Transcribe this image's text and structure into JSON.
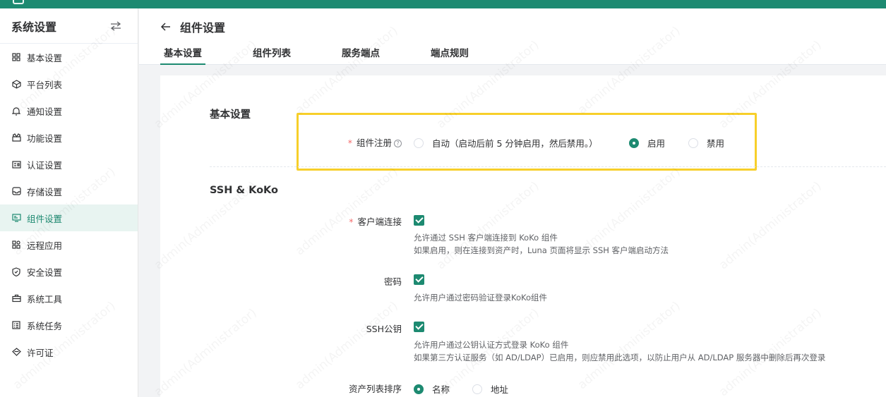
{
  "sidebar": {
    "title": "系统设置",
    "items": [
      {
        "label": "基本设置",
        "icon": "grid-icon"
      },
      {
        "label": "平台列表",
        "icon": "cube-icon"
      },
      {
        "label": "通知设置",
        "icon": "bell-icon"
      },
      {
        "label": "功能设置",
        "icon": "gift-icon"
      },
      {
        "label": "认证设置",
        "icon": "id-card-icon"
      },
      {
        "label": "存储设置",
        "icon": "inbox-icon"
      },
      {
        "label": "组件设置",
        "icon": "monitor-icon",
        "active": true
      },
      {
        "label": "远程应用",
        "icon": "apps-icon"
      },
      {
        "label": "安全设置",
        "icon": "shield-icon"
      },
      {
        "label": "系统工具",
        "icon": "toolbox-icon"
      },
      {
        "label": "系统任务",
        "icon": "task-list-icon"
      },
      {
        "label": "许可证",
        "icon": "license-icon"
      }
    ]
  },
  "header": {
    "title": "组件设置",
    "tabs": [
      {
        "label": "基本设置",
        "active": true
      },
      {
        "label": "组件列表"
      },
      {
        "label": "服务端点"
      },
      {
        "label": "端点规则"
      }
    ]
  },
  "basic": {
    "section_title": "基本设置",
    "registration_label": "组件注册",
    "help_symbol": "?",
    "options": [
      {
        "label": "自动（启动后前 5 分钟启用，然后禁用。）",
        "checked": false
      },
      {
        "label": "启用",
        "checked": true
      },
      {
        "label": "禁用",
        "checked": false
      }
    ]
  },
  "ssh": {
    "section_title": "SSH & KoKo",
    "client_connect_label": "客户端连接",
    "client_connect_help1": "允许通过 SSH 客户端连接到 KoKo 组件",
    "client_connect_help2": "如果启用，则在连接到资产时，Luna 页面将显示 SSH 客户端启动方法",
    "password_label": "密码",
    "password_help": "允许用户通过密码验证登录KoKo组件",
    "pubkey_label": "SSH公钥",
    "pubkey_help1": "允许用户通过公钥认证方式登录 KoKo 组件",
    "pubkey_help2": "如果第三方认证服务（如 AD/LDAP）已启用，则应禁用此选项，以防止用户从 AD/LDAP 服务器中删除后再次登录",
    "asset_sort_label": "资产列表排序",
    "asset_sort_options": [
      {
        "label": "名称",
        "checked": true
      },
      {
        "label": "地址",
        "checked": false
      }
    ]
  },
  "watermark": "admin(Administrator)",
  "colors": {
    "primary": "#1d8a71",
    "highlight": "#f7cf2a",
    "required": "#f56c6c"
  }
}
